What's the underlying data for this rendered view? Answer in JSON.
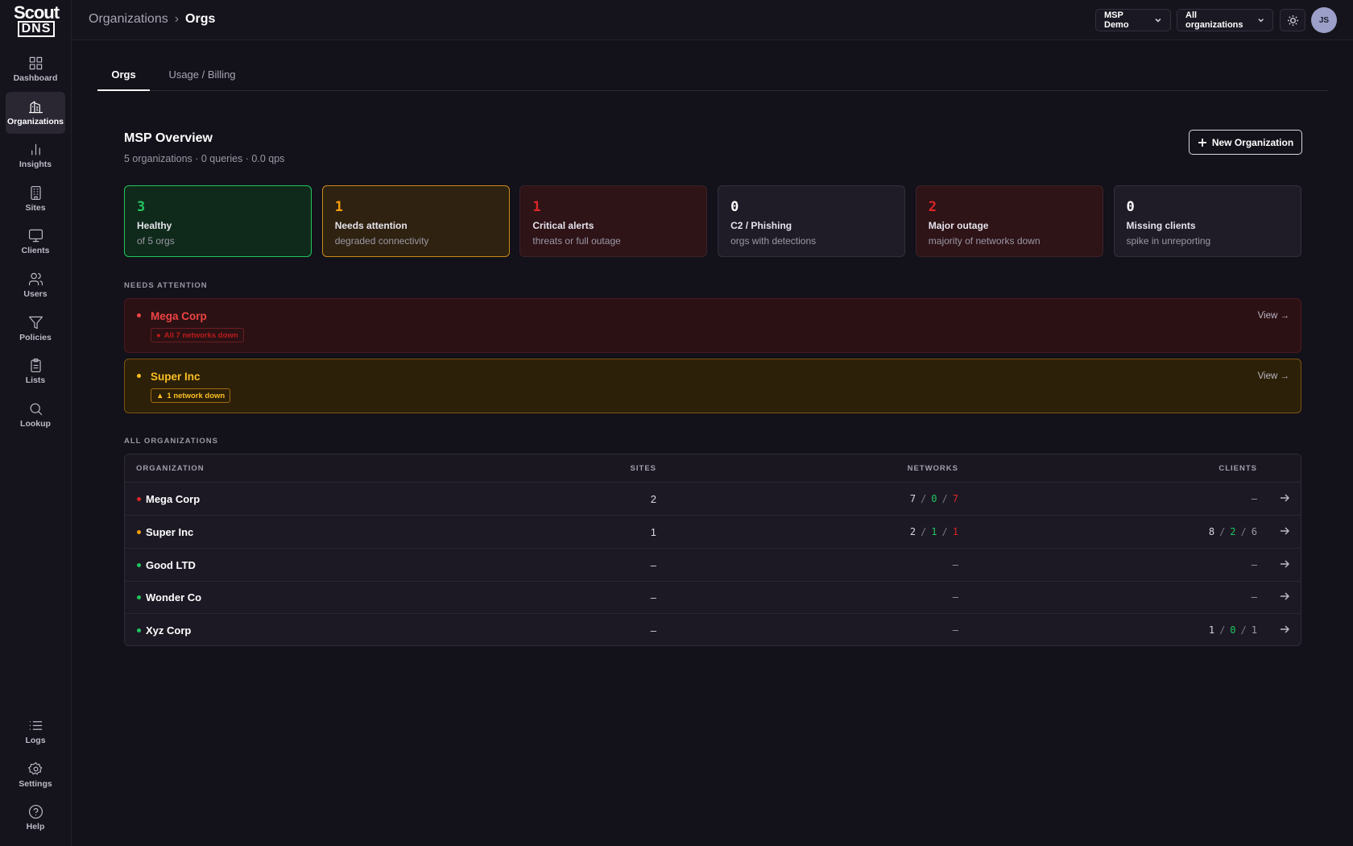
{
  "logo": {
    "line1": "Scout",
    "line2": "DNS"
  },
  "nav": [
    {
      "label": "Dashboard",
      "icon": "grid-icon"
    },
    {
      "label": "Organizations",
      "icon": "building-icon"
    },
    {
      "label": "Insights",
      "icon": "bar-chart-icon"
    },
    {
      "label": "Sites",
      "icon": "office-building-icon"
    },
    {
      "label": "Clients",
      "icon": "monitor-icon"
    },
    {
      "label": "Users",
      "icon": "users-icon"
    },
    {
      "label": "Policies",
      "icon": "filter-icon"
    },
    {
      "label": "Lists",
      "icon": "clipboard-icon"
    },
    {
      "label": "Lookup",
      "icon": "search-icon"
    }
  ],
  "nav_bottom": [
    {
      "label": "Logs",
      "icon": "list-icon"
    },
    {
      "label": "Settings",
      "icon": "gear-icon"
    },
    {
      "label": "Help",
      "icon": "help-circle-icon"
    }
  ],
  "breadcrumb": {
    "parent": "Organizations",
    "separator": "›",
    "current": "Orgs"
  },
  "topbar": {
    "tenant": "MSP Demo",
    "org_filter": "All organizations",
    "avatar": "JS"
  },
  "tabs": [
    "Orgs",
    "Usage / Billing"
  ],
  "overview": {
    "title": "MSP Overview",
    "subtitle": "5 organizations · 0 queries · 0.0 qps",
    "new_button": "New Organization"
  },
  "cards": [
    {
      "value": "3",
      "label": "Healthy",
      "desc": "of 5 orgs",
      "color": "#22c55e"
    },
    {
      "value": "1",
      "label": "Needs attention",
      "desc": "degraded connectivity",
      "color": "#f59e0b"
    },
    {
      "value": "1",
      "label": "Critical alerts",
      "desc": "threats or full outage",
      "color": "#dc2626"
    },
    {
      "value": "0",
      "label": "C2 / Phishing",
      "desc": "orgs with detections",
      "color": "#ffffff"
    },
    {
      "value": "2",
      "label": "Major outage",
      "desc": "majority of networks down",
      "color": "#dc2626"
    },
    {
      "value": "0",
      "label": "Missing clients",
      "desc": "spike in unreporting",
      "color": "#ffffff"
    }
  ],
  "needs_attention": {
    "heading": "NEEDS ATTENTION",
    "items": [
      {
        "name": "Mega Corp",
        "badge": "All 7 networks down",
        "view": "View →",
        "severity": "critical"
      },
      {
        "name": "Super Inc",
        "badge": "1 network down",
        "view": "View →",
        "severity": "warning"
      }
    ]
  },
  "all_orgs": {
    "heading": "ALL ORGANIZATIONS",
    "columns": [
      "ORGANIZATION",
      "SITES",
      "NETWORKS",
      "CLIENTS"
    ],
    "rows": [
      {
        "name": "Mega Corp",
        "status": "critical",
        "sites": "2",
        "networks": [
          "7",
          "0",
          "7"
        ],
        "clients": null
      },
      {
        "name": "Super Inc",
        "status": "warning",
        "sites": "1",
        "networks": [
          "2",
          "1",
          "1"
        ],
        "clients": [
          "8",
          "2",
          "6"
        ]
      },
      {
        "name": "Good LTD",
        "status": "ok",
        "sites": "–",
        "networks": null,
        "clients": null
      },
      {
        "name": "Wonder Co",
        "status": "ok",
        "sites": "–",
        "networks": null,
        "clients": null
      },
      {
        "name": "Xyz Corp",
        "status": "ok",
        "sites": "–",
        "networks": null,
        "clients": [
          "1",
          "0",
          "1"
        ]
      }
    ],
    "empty": "–"
  },
  "colors": {
    "ok": "#22c55e",
    "warning": "#f59e0b",
    "critical": "#dc2626"
  }
}
